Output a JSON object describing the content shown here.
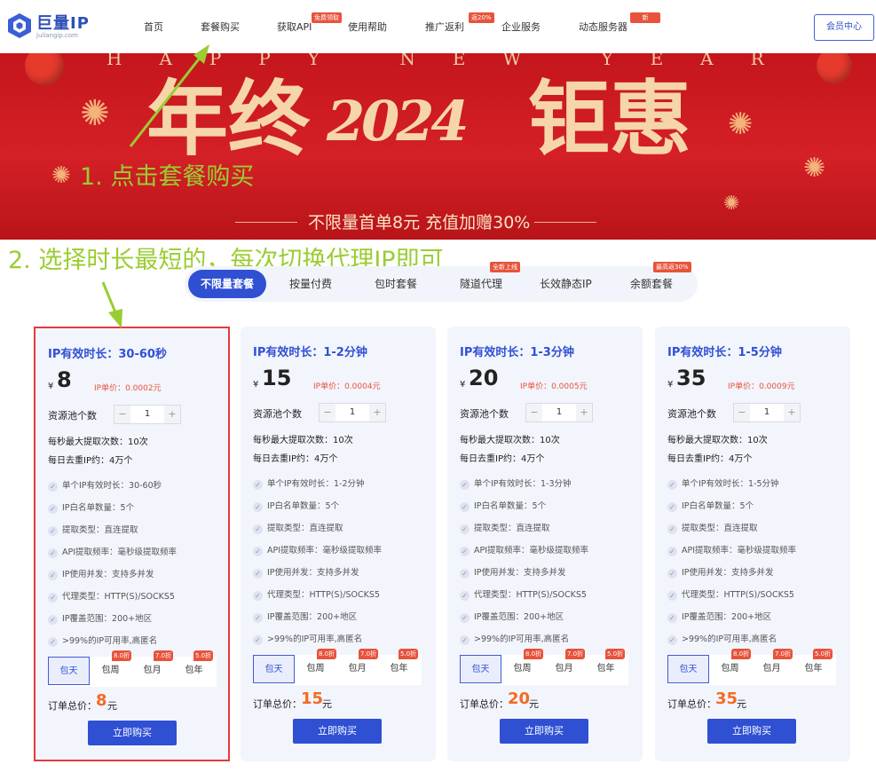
{
  "header": {
    "logo_text": "巨量IP",
    "logo_sub": "juliangip.com",
    "nav": [
      {
        "label": "首页"
      },
      {
        "label": "套餐购买"
      },
      {
        "label": "获取API",
        "badge": "免费领取"
      },
      {
        "label": "使用帮助"
      },
      {
        "label": "推广返利",
        "badge": "返20%"
      },
      {
        "label": "企业服务"
      },
      {
        "label": "动态服务器",
        "badge": "新"
      }
    ],
    "member_button": "会员中心"
  },
  "banner": {
    "happy": "HAPPY NEW YEAR",
    "title_left": "年终",
    "title_year": "2024",
    "title_right": "钜惠",
    "subtitle": "不限量首单8元 充值加赠30%"
  },
  "annotations": {
    "step1": "1. 点击套餐购买",
    "step2": "2. 选择时长最短的，每次切换代理IP即可"
  },
  "tabs": [
    {
      "label": "不限量套餐",
      "active": true
    },
    {
      "label": "按量付费"
    },
    {
      "label": "包时套餐"
    },
    {
      "label": "隧道代理",
      "badge": "全新上线"
    },
    {
      "label": "长效静态IP"
    },
    {
      "label": "余额套餐",
      "badge": "最高返30%"
    }
  ],
  "plans": [
    {
      "title": "IP有效时长：30-60秒",
      "currency": "¥",
      "price": "8",
      "unit_price": "IP单价：0.0002元",
      "pool_label": "资源池个数",
      "pool_value": "1",
      "max_extract": "每秒最大提取次数：10次",
      "daily_dedup": "每日去重IP约：4万个",
      "features": [
        "单个IP有效时长：30-60秒",
        "IP白名单数量：5个",
        "提取类型：直连提取",
        "API提取频率：毫秒级提取频率",
        "IP使用并发：支持多并发",
        "代理类型：HTTP(S)/SOCKS5",
        "IP覆盖范围：200+地区",
        ">99%的IP可用率,高匿名"
      ],
      "total_label": "订单总价：",
      "total_value": "8",
      "total_unit": "元",
      "buy": "立即购买",
      "highlighted": true
    },
    {
      "title": "IP有效时长：1-2分钟",
      "currency": "¥",
      "price": "15",
      "unit_price": "IP单价：0.0004元",
      "pool_label": "资源池个数",
      "pool_value": "1",
      "max_extract": "每秒最大提取次数：10次",
      "daily_dedup": "每日去重IP约：4万个",
      "features": [
        "单个IP有效时长：1-2分钟",
        "IP白名单数量：5个",
        "提取类型：直连提取",
        "API提取频率：毫秒级提取频率",
        "IP使用并发：支持多并发",
        "代理类型：HTTP(S)/SOCKS5",
        "IP覆盖范围：200+地区",
        ">99%的IP可用率,高匿名"
      ],
      "total_label": "订单总价：",
      "total_value": "15",
      "total_unit": "元",
      "buy": "立即购买",
      "highlighted": false
    },
    {
      "title": "IP有效时长：1-3分钟",
      "currency": "¥",
      "price": "20",
      "unit_price": "IP单价：0.0005元",
      "pool_label": "资源池个数",
      "pool_value": "1",
      "max_extract": "每秒最大提取次数：10次",
      "daily_dedup": "每日去重IP约：4万个",
      "features": [
        "单个IP有效时长：1-3分钟",
        "IP白名单数量：5个",
        "提取类型：直连提取",
        "API提取频率：毫秒级提取频率",
        "IP使用并发：支持多并发",
        "代理类型：HTTP(S)/SOCKS5",
        "IP覆盖范围：200+地区",
        ">99%的IP可用率,高匿名"
      ],
      "total_label": "订单总价：",
      "total_value": "20",
      "total_unit": "元",
      "buy": "立即购买",
      "highlighted": false
    },
    {
      "title": "IP有效时长：1-5分钟",
      "currency": "¥",
      "price": "35",
      "unit_price": "IP单价：0.0009元",
      "pool_label": "资源池个数",
      "pool_value": "1",
      "max_extract": "每秒最大提取次数：10次",
      "daily_dedup": "每日去重IP约：4万个",
      "features": [
        "单个IP有效时长：1-5分钟",
        "IP白名单数量：5个",
        "提取类型：直连提取",
        "API提取频率：毫秒级提取频率",
        "IP使用并发：支持多并发",
        "代理类型：HTTP(S)/SOCKS5",
        "IP覆盖范围：200+地区",
        ">99%的IP可用率,高匿名"
      ],
      "total_label": "订单总价：",
      "total_value": "35",
      "total_unit": "元",
      "buy": "立即购买",
      "highlighted": false
    }
  ],
  "periods": [
    {
      "label": "包天",
      "selected": true
    },
    {
      "label": "包周",
      "badge": "8.0折"
    },
    {
      "label": "包月",
      "badge": "7.0折"
    },
    {
      "label": "包年",
      "badge": "5.0折"
    }
  ],
  "colors": {
    "primary": "#2f50d3",
    "accent": "#f36b21",
    "badge": "#e8533b",
    "annotation": "#9acd32",
    "highlight_border": "#e33b3b",
    "banner_red": "#c4161c"
  },
  "icons": {
    "check": "check-circle-icon",
    "plus": "plus-icon",
    "minus": "minus-icon",
    "arrow": "annotation-arrow-icon"
  }
}
